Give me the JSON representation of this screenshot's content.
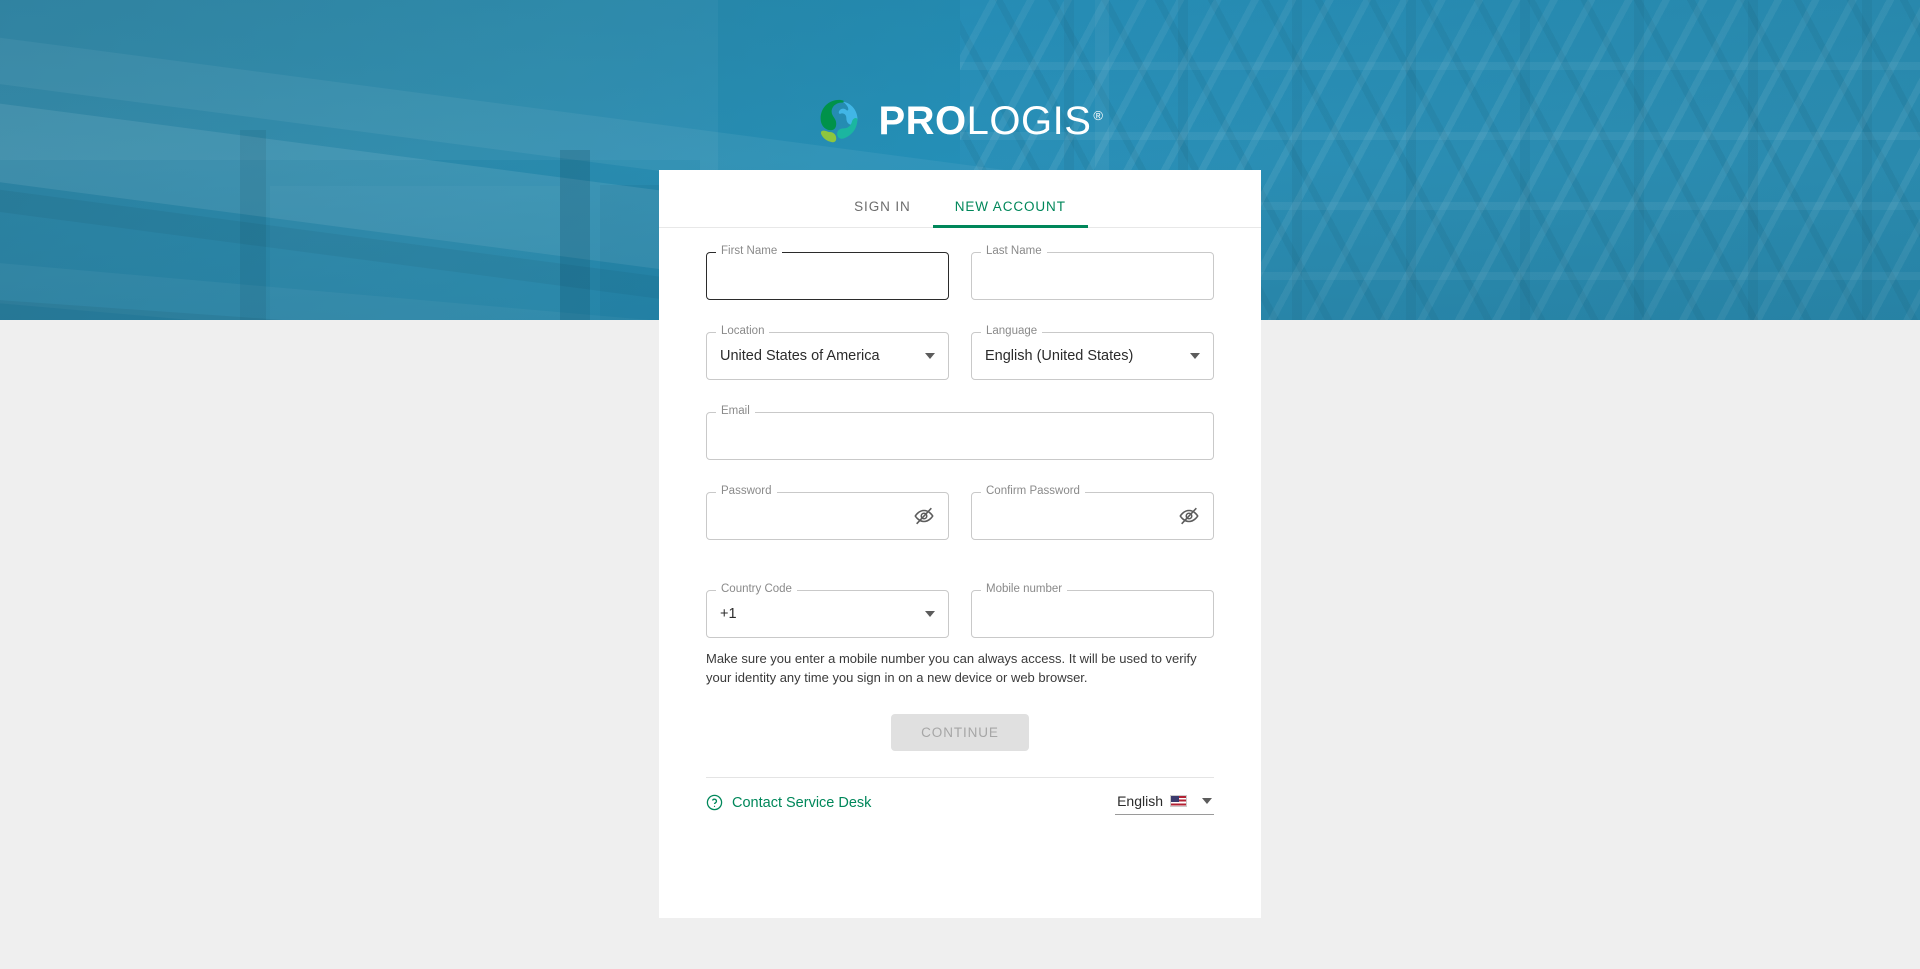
{
  "brand": {
    "name_bold": "PRO",
    "name_light": "LOGIS",
    "registered_mark": "®",
    "logo_icon": "prologis-globe-icon",
    "colors": {
      "green": "#00875A",
      "globe_green": "#00924A",
      "globe_lime": "#8DC63F",
      "globe_teal": "#1BB6A0",
      "globe_blue": "#41B6E6",
      "hero_blue": "#2b8cae",
      "page_background": "#efefef"
    }
  },
  "tabs": [
    {
      "label": "SIGN IN",
      "active": false
    },
    {
      "label": "NEW ACCOUNT",
      "active": true
    }
  ],
  "form": {
    "first_name": {
      "label": "First Name",
      "value": "",
      "placeholder": "",
      "focused": true
    },
    "last_name": {
      "label": "Last Name",
      "value": "",
      "placeholder": ""
    },
    "location": {
      "label": "Location",
      "value": "United States of America",
      "icon": "chevron-down-icon"
    },
    "language": {
      "label": "Language",
      "value": "English (United States)",
      "icon": "chevron-down-icon"
    },
    "email": {
      "label": "Email",
      "value": "",
      "placeholder": ""
    },
    "password": {
      "label": "Password",
      "value": "",
      "icon": "visibility-off-icon"
    },
    "confirm_password": {
      "label": "Confirm Password",
      "value": "",
      "icon": "visibility-off-icon"
    },
    "country_code": {
      "label": "Country Code",
      "value": "+1",
      "icon": "chevron-down-icon"
    },
    "mobile_number": {
      "label": "Mobile number",
      "value": "",
      "placeholder": ""
    },
    "helper_text": "Make sure you enter a mobile number you can always access. It will be used to verify your identity any time you sign in on a new device or web browser.",
    "continue_button": {
      "label": "CONTINUE",
      "disabled": true
    }
  },
  "footer": {
    "service_desk": {
      "label": "Contact Service Desk",
      "icon": "help-circle-icon"
    },
    "language_selector": {
      "label": "English",
      "flag": "us-flag-icon",
      "icon": "chevron-down-icon"
    }
  }
}
